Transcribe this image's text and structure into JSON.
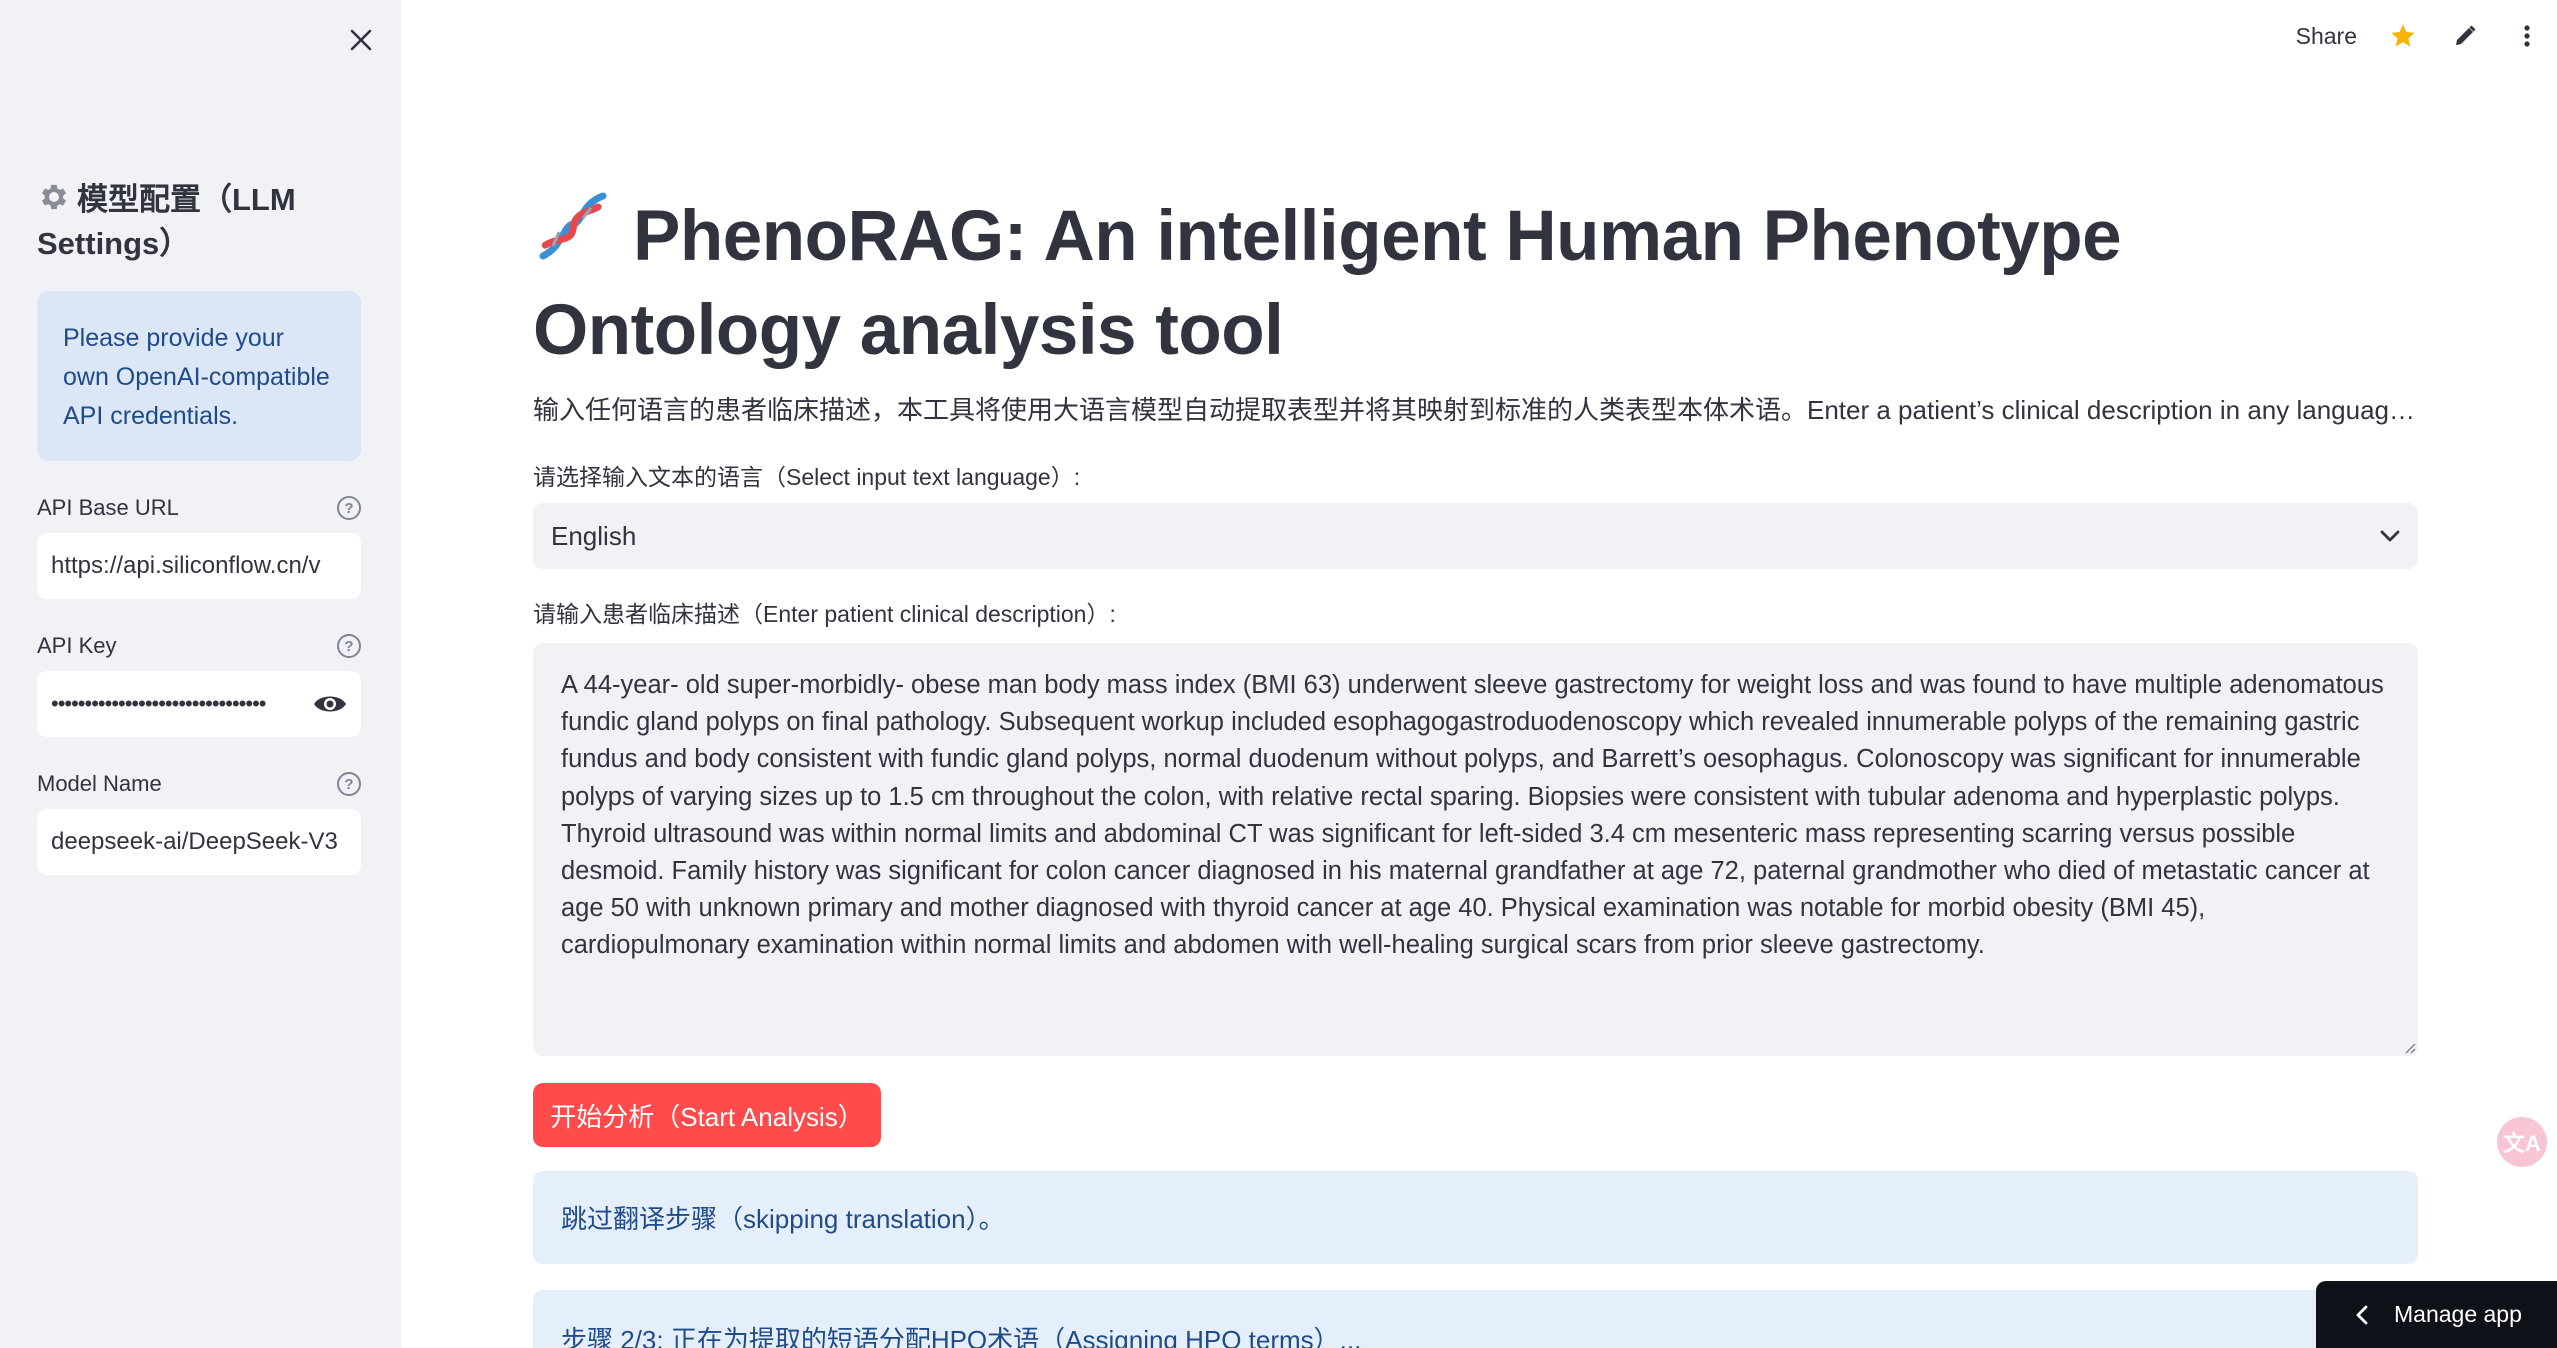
{
  "sidebar": {
    "title": "模型配置（LLM Settings）",
    "info": "Please provide your own OpenAI-compatible API credentials.",
    "fields": [
      {
        "label": "API Base URL",
        "value": "https://api.siliconflow.cn/v"
      },
      {
        "label": "API Key",
        "value": "••••••••••••••••••••••••••••••••"
      },
      {
        "label": "Model Name",
        "value": "deepseek-ai/DeepSeek-V3"
      }
    ],
    "icons": {
      "close": "close-icon",
      "gear": "gear-icon",
      "help": "help-icon",
      "eye": "eye-icon"
    }
  },
  "toolbar": {
    "share_label": "Share",
    "icons": [
      "star-icon",
      "pencil-icon",
      "kebab-menu-icon"
    ],
    "star_color": "#f5b400"
  },
  "main": {
    "title": "PhenoRAG: An intelligent Human Phenotype Ontology analysis tool",
    "subtitle": "输入任何语言的患者临床描述，本工具将使用大语言模型自动提取表型并将其映射到标准的人类表型本体术语。Enter a patient’s clinical description in any language...",
    "language_label": "请选择输入文本的语言（Select input text language）:",
    "language_value": "English",
    "description_label": "请输入患者临床描述（Enter patient clinical description）:",
    "description_value": "A 44-year- old super-morbidly- obese man body mass index (BMI 63) underwent sleeve gastrectomy for weight loss and was found to have multiple adenomatous fundic gland polyps on final pathology. Subsequent workup included esophagogastroduodenoscopy which revealed innumerable polyps of the remaining gastric fundus and body consistent with fundic gland polyps, normal duodenum without polyps, and Barrett’s oesophagus. Colonoscopy was significant for innumerable polyps of varying sizes up to 1.5 cm throughout the colon, with relative rectal sparing. Biopsies were consistent with tubular adenoma and hyperplastic polyps. Thyroid ultrasound was within normal limits and abdominal CT was significant for left-sided 3.4 cm mesenteric mass representing scarring versus possible desmoid. Family history was significant for colon cancer diagnosed in his maternal grandfather at age 72, paternal grandmother who died of metastatic cancer at age 50 with unknown primary and mother diagnosed with thyroid cancer at age 40. Physical examination was notable for morbid obesity (BMI 45), cardiopulmonary examination within normal limits and abdomen with well-healing surgical scars from prior sleeve gastrectomy.",
    "start_button": "开始分析（Start Analysis）",
    "status_skip": "跳过翻译步骤（skipping translation）。",
    "status_step2": "步骤 2/3: 正在为提取的短语分配HPO术语（Assigning HPO terms）..."
  },
  "manage_app": "Manage app",
  "colors": {
    "primary_button": "#ff4b4b",
    "info_bg": "#e5effb",
    "info_text": "#1f4b8a",
    "sidebar_bg": "#f0f2f6"
  }
}
